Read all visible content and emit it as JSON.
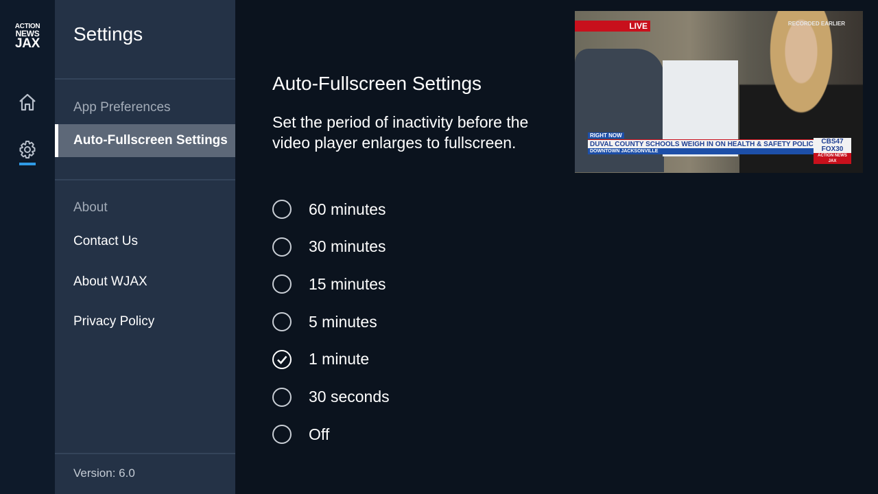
{
  "brand": {
    "logo_text": [
      "ACTION",
      "NEWS",
      "JAX"
    ]
  },
  "rail": {
    "items": [
      {
        "icon": "home-icon"
      },
      {
        "icon": "gear-icon",
        "active": true
      }
    ],
    "accent": "#2f9be6"
  },
  "sidebar": {
    "title": "Settings",
    "sections": [
      {
        "header": "App Preferences",
        "items": [
          {
            "label": "Auto-Fullscreen Settings",
            "selected": true
          }
        ]
      },
      {
        "header": "About",
        "items": [
          {
            "label": "Contact Us"
          },
          {
            "label": "About WJAX"
          },
          {
            "label": "Privacy Policy"
          }
        ]
      }
    ],
    "version": "Version: 6.0"
  },
  "main": {
    "title": "Auto-Fullscreen Settings",
    "description": "Set the period of inactivity before the video player enlarges to fullscreen.",
    "options": [
      {
        "label": "60 minutes",
        "checked": false
      },
      {
        "label": "30 minutes",
        "checked": false
      },
      {
        "label": "15 minutes",
        "checked": false
      },
      {
        "label": "5 minutes",
        "checked": false
      },
      {
        "label": "1 minute",
        "checked": true
      },
      {
        "label": "30 seconds",
        "checked": false
      },
      {
        "label": "Off",
        "checked": false
      }
    ]
  },
  "video": {
    "live_badge": "LIVE",
    "recorded": "RECORDED EARLIER",
    "right_now": "RIGHT NOW",
    "headline": "DUVAL COUNTY SCHOOLS WEIGH IN ON HEALTH & SAFETY POLICY",
    "location": "DOWNTOWN JACKSONVILLE",
    "network_1": "CBS47",
    "network_2": "FOX30",
    "network_3": "ACTION NEWS JAX"
  }
}
